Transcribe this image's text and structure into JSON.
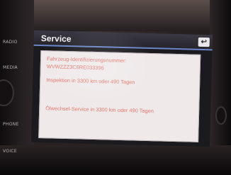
{
  "side_buttons": [
    "RADIO",
    "MEDIA",
    "PHONE",
    "VOICE"
  ],
  "screen": {
    "title": "Service",
    "back_icon": "back-arrow-icon",
    "lines": {
      "vin_label": "Fahrzeug-Identifizierungsnummer:",
      "vin_value": "WVWZZZ3C6RE033396",
      "inspection": "Inspektion in 3300 km oder 490 Tagen",
      "oil_service": "Ölwechsel-Service in 3300 km oder 490 Tagen"
    }
  },
  "colors": {
    "panel_text": "#e4786d",
    "accent_line": "#6a86c9"
  }
}
